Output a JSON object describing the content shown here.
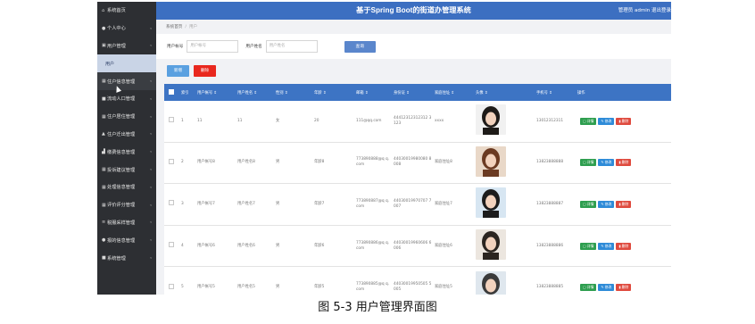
{
  "header": {
    "title": "基于Spring Boot的街道办管理系统",
    "user": "管理员 admin  退出登录"
  },
  "sidebar": {
    "items": [
      {
        "label": "系统首页",
        "icon": "home-icon",
        "glyph": "⌂"
      },
      {
        "label": "个人中心",
        "icon": "person-icon",
        "glyph": "●"
      },
      {
        "label": "用户管理",
        "icon": "users-icon",
        "glyph": "▣"
      },
      {
        "label": "用户",
        "sub": true
      },
      {
        "label": "住户信息管理",
        "icon": "grid-icon",
        "glyph": "▦",
        "active": true
      },
      {
        "label": "流动人口管理",
        "icon": "doc-icon",
        "glyph": "■"
      },
      {
        "label": "住户居住管理",
        "icon": "grid-icon",
        "glyph": "▦"
      },
      {
        "label": "住户迁出管理",
        "icon": "flag-icon",
        "glyph": "▲"
      },
      {
        "label": "缴费信息管理",
        "icon": "bank-icon",
        "glyph": "▟"
      },
      {
        "label": "投诉建议管理",
        "icon": "grid-icon",
        "glyph": "▦"
      },
      {
        "label": "处理信息管理",
        "icon": "grid-icon",
        "glyph": "▦"
      },
      {
        "label": "评价评分管理",
        "icon": "grid-icon",
        "glyph": "▦"
      },
      {
        "label": "税服采样管理",
        "icon": "list-icon",
        "glyph": "≡"
      },
      {
        "label": "报的信息管理",
        "icon": "person-icon",
        "glyph": "●"
      },
      {
        "label": "系统管理",
        "icon": "doc-icon",
        "glyph": "■"
      }
    ]
  },
  "breadcrumb": {
    "home": "系统首页",
    "current": "用户"
  },
  "search": {
    "account_label": "用户帐号",
    "account_placeholder": "用户帐号",
    "name_label": "用户姓名",
    "name_placeholder": "用户姓名",
    "button": "查询"
  },
  "actions": {
    "add": "新增",
    "delete": "删除"
  },
  "table": {
    "columns": [
      "索引",
      "用户帐号 ⇕",
      "用户姓名 ⇕",
      "性别 ⇕",
      "年龄 ⇕",
      "邮箱 ⇕",
      "身份证 ⇕",
      "家庭住址 ⇕",
      "头像 ⇕",
      "手机号 ⇕",
      "操作"
    ],
    "ops": {
      "detail": "▢ 详情",
      "edit": "✎ 修改",
      "delete": "▮ 删除"
    },
    "rows": [
      {
        "index": "1",
        "account": "11",
        "name": "11",
        "gender": "女",
        "age": "20",
        "email": "111@qq.com",
        "id": "44412312312312 3123",
        "address": "xxxx",
        "phone": "13012312311"
      },
      {
        "index": "2",
        "account": "用户帐号8",
        "name": "用户姓名8",
        "gender": "男",
        "age": "年龄8",
        "email": "773890888@q q.com",
        "id": "44030019980080 8008",
        "address": "家庭住址8",
        "phone": "13823888888"
      },
      {
        "index": "3",
        "account": "用户帐号7",
        "name": "用户姓名7",
        "gender": "男",
        "age": "年龄7",
        "email": "773890887@q q.com",
        "id": "44030019970707 7007",
        "address": "家庭住址7",
        "phone": "13823888887"
      },
      {
        "index": "4",
        "account": "用户帐号6",
        "name": "用户姓名6",
        "gender": "男",
        "age": "年龄6",
        "email": "773890886@q q.com",
        "id": "44030019960606 6006",
        "address": "家庭住址6",
        "phone": "13823888886"
      },
      {
        "index": "5",
        "account": "用户帐号5",
        "name": "用户姓名5",
        "gender": "男",
        "age": "年龄5",
        "email": "773890885@q q.com",
        "id": "44030019950505 5005",
        "address": "家庭住址5",
        "phone": "13823888885"
      }
    ]
  },
  "caption": "图 5-3 用户管理界面图"
}
